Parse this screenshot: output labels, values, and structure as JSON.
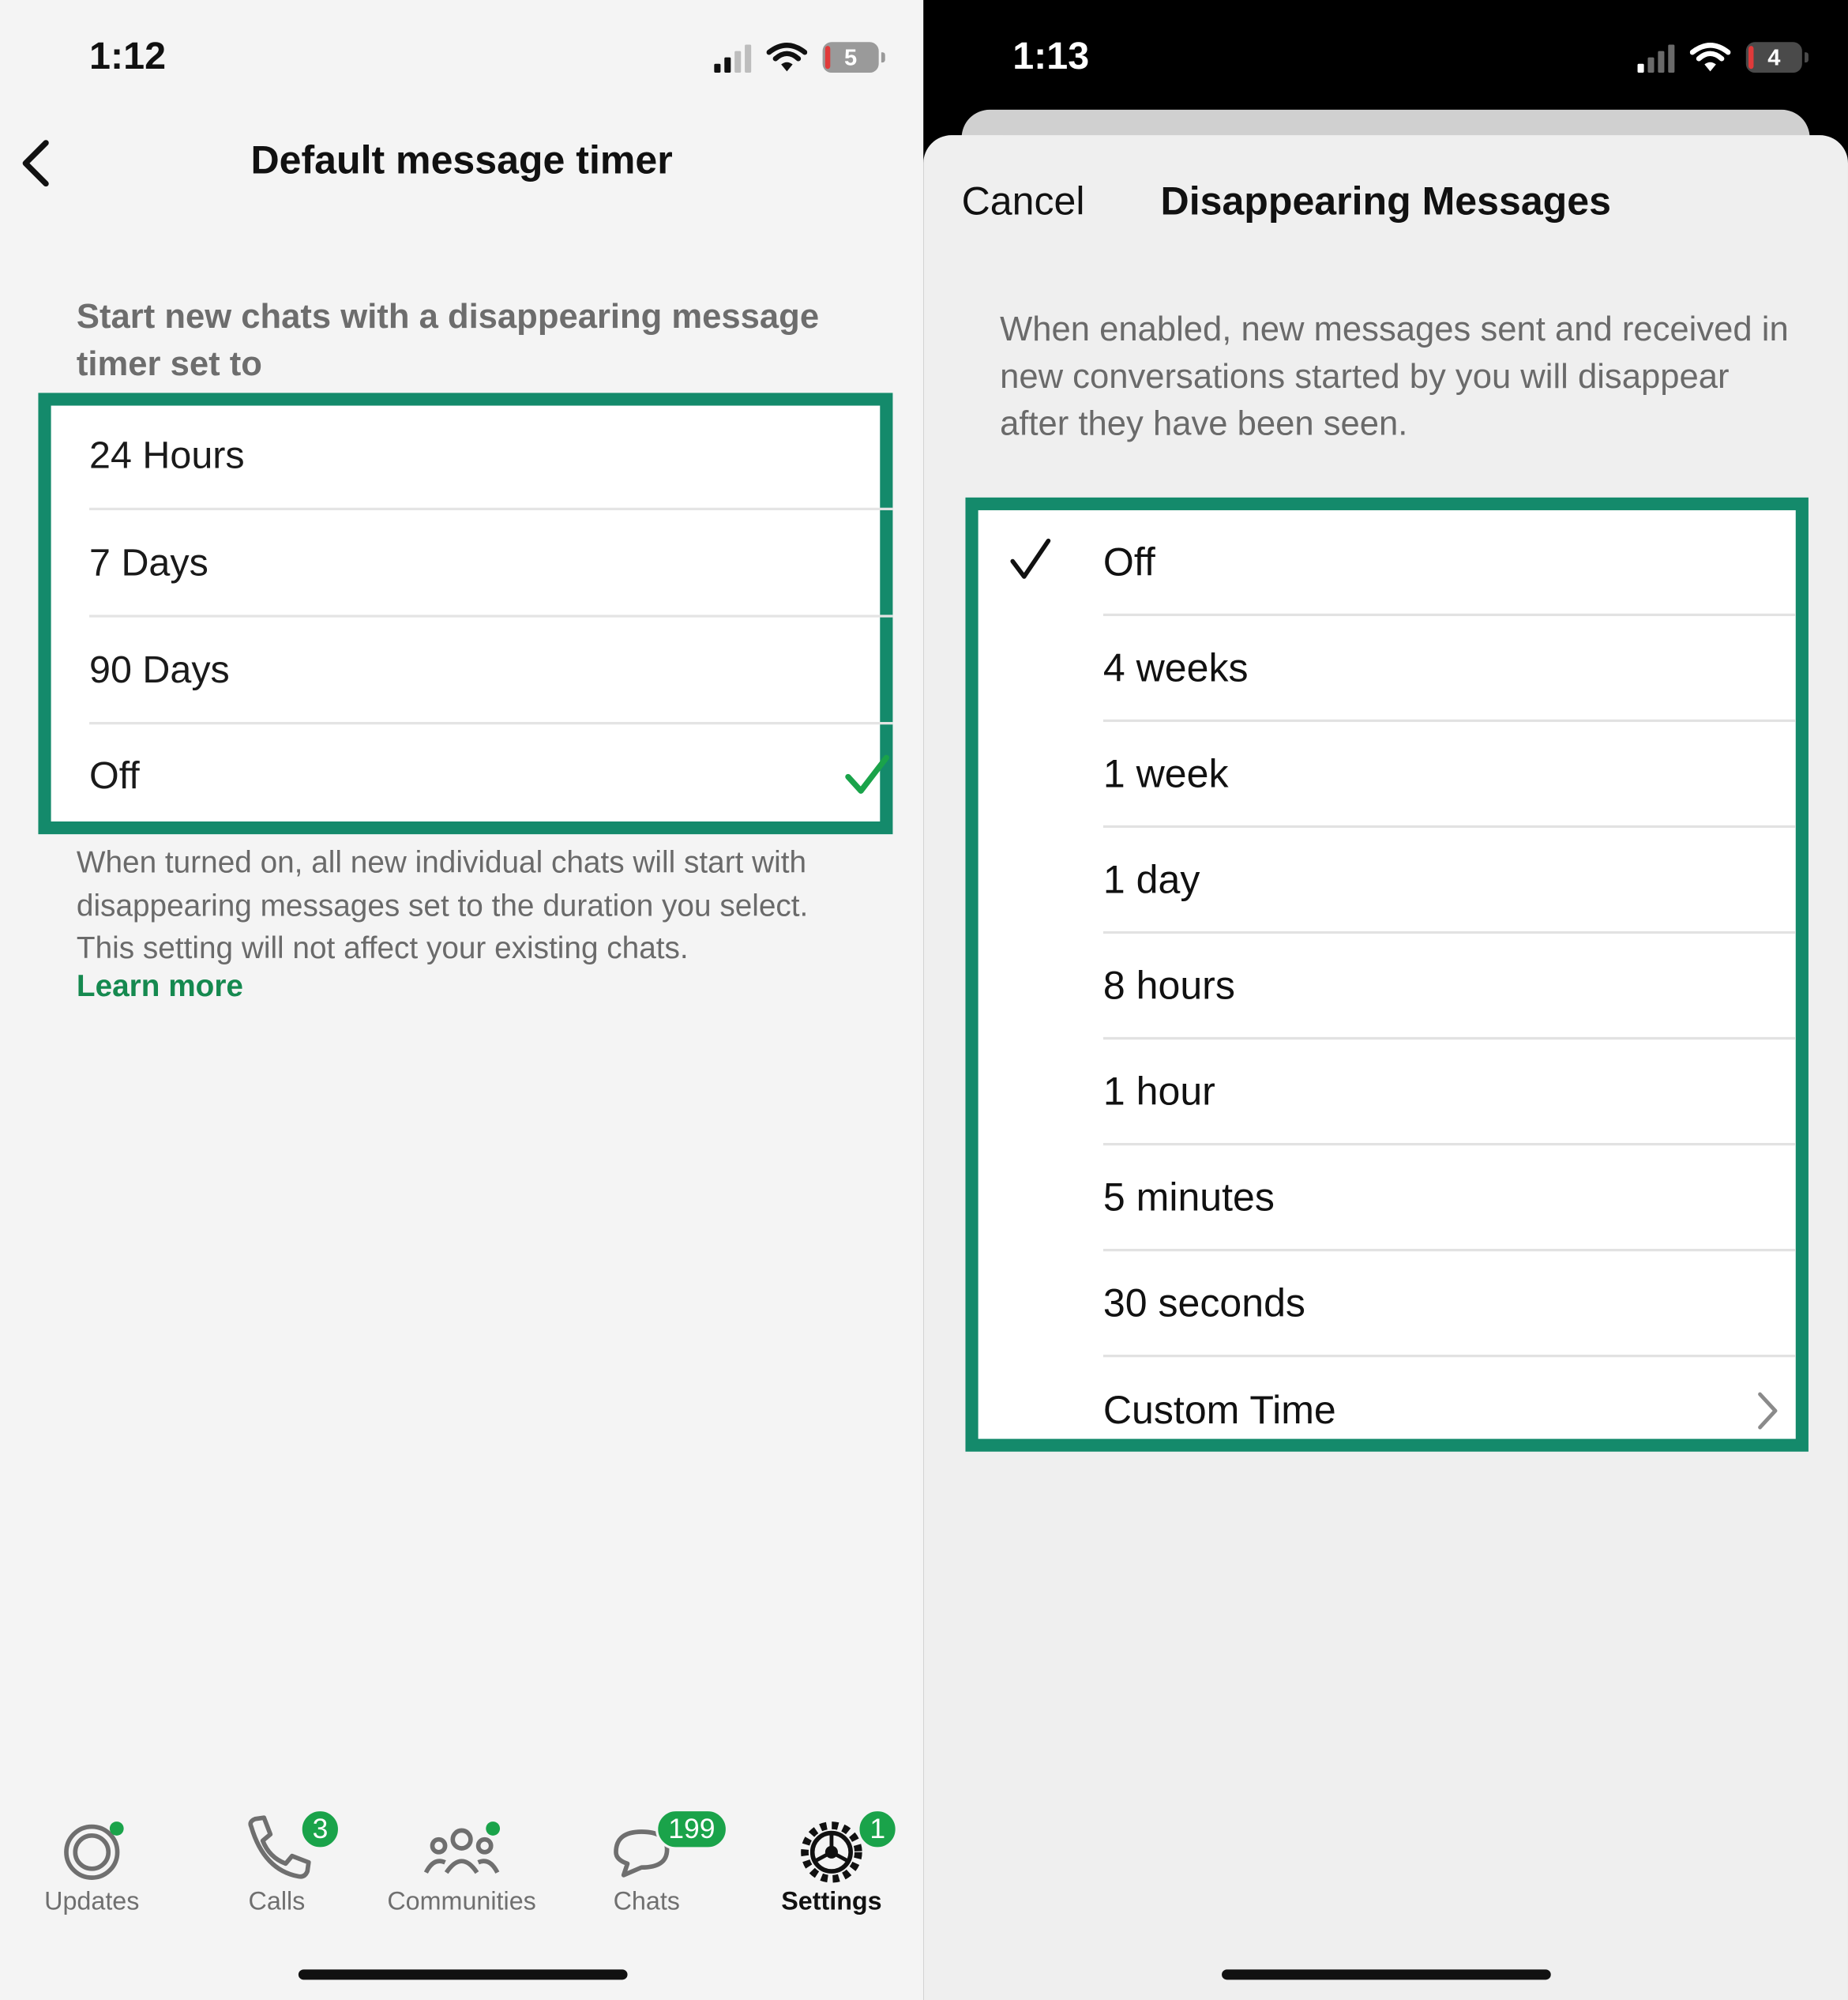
{
  "left": {
    "status_time": "1:12",
    "battery_level": "5",
    "title": "Default message timer",
    "section_header": "Start new chats with a disappearing message timer set to",
    "options": [
      {
        "label": "24 Hours",
        "selected": false
      },
      {
        "label": "7 Days",
        "selected": false
      },
      {
        "label": "90 Days",
        "selected": false
      },
      {
        "label": "Off",
        "selected": true
      }
    ],
    "footnote": "When turned on, all new individual chats will start with disappearing messages set to the duration you select. This setting will not affect your existing chats.",
    "learn_more": "Learn more",
    "tabs": [
      {
        "label": "Updates",
        "icon": "updates-icon"
      },
      {
        "label": "Calls",
        "icon": "phone-icon",
        "badge": "3"
      },
      {
        "label": "Communities",
        "icon": "communities-icon"
      },
      {
        "label": "Chats",
        "icon": "chat-bubbles-icon",
        "badge": "199"
      },
      {
        "label": "Settings",
        "icon": "gear-icon",
        "badge": "1",
        "active": true
      }
    ]
  },
  "right": {
    "status_time": "1:13",
    "battery_level": "4",
    "cancel_label": "Cancel",
    "title": "Disappearing Messages",
    "description": "When enabled, new messages sent and received in new conversations started by you will disappear after they have been seen.",
    "options": [
      {
        "label": "Off",
        "selected": true
      },
      {
        "label": "4 weeks"
      },
      {
        "label": "1 week"
      },
      {
        "label": "1 day"
      },
      {
        "label": "8 hours"
      },
      {
        "label": "1 hour"
      },
      {
        "label": "5 minutes"
      },
      {
        "label": "30 seconds"
      },
      {
        "label": "Custom Time",
        "has_chevron": true
      }
    ]
  },
  "colors": {
    "highlight_border": "#148a6b",
    "whatsapp_green": "#1aa34a",
    "link_green": "#15894f"
  }
}
